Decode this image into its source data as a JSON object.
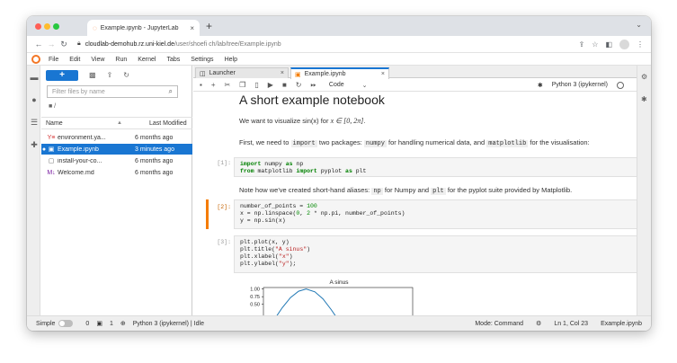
{
  "browser": {
    "tab_title": "Example.ipynb - JupyterLab",
    "tab_close": "×",
    "new_tab": "+",
    "url_host": "cloudlab-demohub.rz.uni-kiel.de",
    "url_path": "/user/shoefi ch/lab/tree/Example.ipynb"
  },
  "menu": [
    "File",
    "Edit",
    "View",
    "Run",
    "Kernel",
    "Tabs",
    "Settings",
    "Help"
  ],
  "filebrowser": {
    "new_button": "+",
    "filter_placeholder": "Filter files by name",
    "breadcrumb": "■ /",
    "col_name": "Name",
    "col_modified": "Last Modified",
    "files": [
      {
        "icon": "Y≡",
        "name": "environment.ya...",
        "modified": "6 months ago",
        "running": false,
        "selected": false,
        "icon_color": "#d32f2f"
      },
      {
        "icon": "▣",
        "name": "Example.ipynb",
        "modified": "3 minutes ago",
        "running": true,
        "selected": true,
        "icon_color": "#ffffff"
      },
      {
        "icon": "▢",
        "name": "install-your-co...",
        "modified": "6 months ago",
        "running": false,
        "selected": false,
        "icon_color": "#616161"
      },
      {
        "icon": "M↓",
        "name": "Welcome.md",
        "modified": "6 months ago",
        "running": false,
        "selected": false,
        "icon_color": "#7b1fa2"
      }
    ]
  },
  "doc_tabs": {
    "launcher": "Launcher",
    "notebook": "Example.ipynb",
    "close": "×"
  },
  "nb_toolbar": {
    "cell_type": "Code",
    "kernel_name": "Python 3 (ipykernel)"
  },
  "notebook": {
    "title": "A short example notebook",
    "p1_text": "We want to visualize sin(x) for",
    "p1_math": "x ∈ [0, 2π]",
    "p1_end": ".",
    "p2_a": "First, we need to",
    "p2_code1": "import",
    "p2_b": "two packages:",
    "p2_code2": "numpy",
    "p2_c": "for handling numerical data, and",
    "p2_code3": "matplotlib",
    "p2_d": "for the visualisation:",
    "cell1_prompt": "[1]:",
    "p3_a": "Note how we've created short-hand aliases:",
    "p3_code1": "np",
    "p3_b": "for Numpy and",
    "p3_code2": "plt",
    "p3_c": "for the pyplot suite provided by Matplotlib.",
    "cell2_prompt": "[2]:",
    "cell3_prompt": "[3]:"
  },
  "chart_data": {
    "type": "line",
    "title": "A sinus",
    "ytick_labels": [
      "1.00",
      "0.75",
      "0.50"
    ],
    "x": [
      0.0,
      0.4,
      0.8,
      1.2,
      1.57,
      2.0,
      2.4,
      2.8,
      3.14
    ],
    "y": [
      0.0,
      0.39,
      0.72,
      0.93,
      1.0,
      0.91,
      0.68,
      0.33,
      0.0
    ],
    "color": "#1f77b4"
  },
  "status": {
    "mode_label": "Simple",
    "count_a": "0",
    "count_b": "1",
    "kernel_status": "Python 3 (ipykernel) | Idle",
    "mode": "Mode: Command",
    "position": "Ln 1, Col 23",
    "filename": "Example.ipynb"
  }
}
